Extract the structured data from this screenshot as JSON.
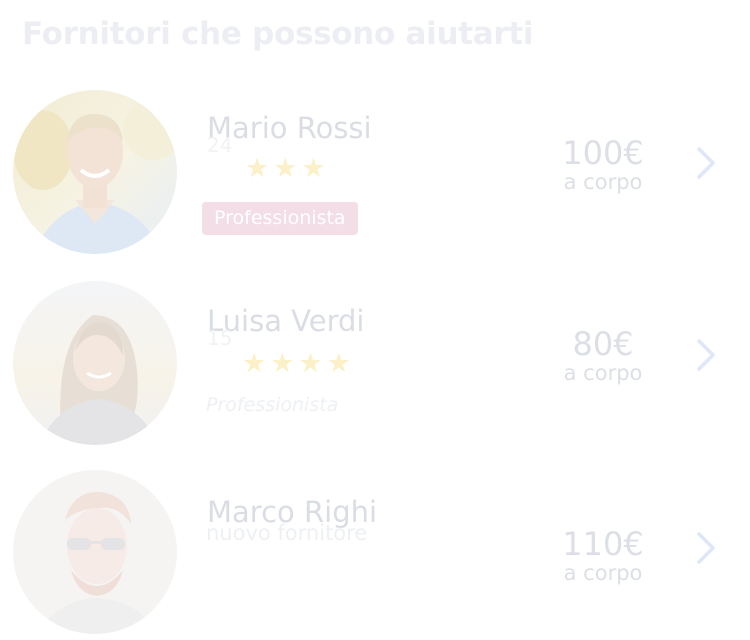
{
  "header": {
    "title": "Fornitori che possono aiutarti"
  },
  "colors": {
    "title": "#eceef3",
    "name": "#dadde4",
    "star": "#fbf0c7",
    "badge_bg": "#f3dde6",
    "price": "#dcdfe5",
    "chevron": "#dfe6f7"
  },
  "suppliers": [
    {
      "name": "Mario Rossi",
      "reviews": "24",
      "stars": "★★★",
      "rating": 3,
      "badge": "Professionista",
      "price": "100€",
      "unit": "a corpo",
      "avatar_icon": "avatar-man-outdoor"
    },
    {
      "name": "Luisa Verdi",
      "reviews": "15",
      "stars": "★★★★",
      "rating": 4,
      "role": "Professionista",
      "price": "80€",
      "unit": "a corpo",
      "avatar_icon": "avatar-woman-smiling"
    },
    {
      "name": "Marco Righi",
      "subtitle": "nuovo fornitore",
      "price": "110€",
      "unit": "a corpo",
      "avatar_icon": "avatar-man-sunglasses"
    }
  ]
}
